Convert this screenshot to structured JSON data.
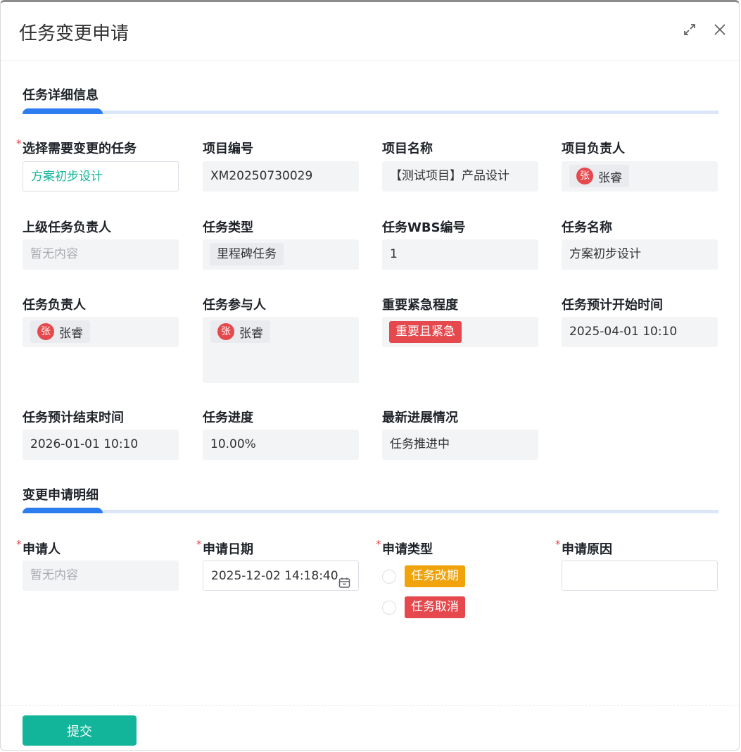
{
  "dialog": {
    "title": "任务变更申请",
    "icons": {
      "expand": "expand-icon",
      "close": "close-icon"
    }
  },
  "section1": {
    "title": "任务详细信息",
    "fields": {
      "task_select": {
        "label": "选择需要变更的任务",
        "value": "方案初步设计"
      },
      "project_code": {
        "label": "项目编号",
        "value": "XM20250730029"
      },
      "project_name": {
        "label": "项目名称",
        "value": "【测试项目】产品设计"
      },
      "project_owner": {
        "label": "项目负责人",
        "avatar": "张",
        "name": "张睿"
      },
      "parent_owner": {
        "label": "上级任务负责人",
        "value": "暂无内容"
      },
      "task_type": {
        "label": "任务类型",
        "value": "里程碑任务"
      },
      "wbs": {
        "label": "任务WBS编号",
        "value": "1"
      },
      "task_name": {
        "label": "任务名称",
        "value": "方案初步设计"
      },
      "task_owner": {
        "label": "任务负责人",
        "avatar": "张",
        "name": "张睿"
      },
      "participants": {
        "label": "任务参与人",
        "avatar": "张",
        "name": "张睿"
      },
      "priority": {
        "label": "重要紧急程度",
        "value": "重要且紧急"
      },
      "start_time": {
        "label": "任务预计开始时间",
        "value": "2025-04-01 10:10"
      },
      "end_time": {
        "label": "任务预计结束时间",
        "value": "2026-01-01 10:10"
      },
      "progress": {
        "label": "任务进度",
        "value": "10.00%"
      },
      "latest": {
        "label": "最新进展情况",
        "value": "任务推进中"
      }
    }
  },
  "section2": {
    "title": "变更申请明细",
    "fields": {
      "applicant": {
        "label": "申请人",
        "value": "暂无内容"
      },
      "apply_date": {
        "label": "申请日期",
        "value": "2025-12-02 14:18:40"
      },
      "apply_type": {
        "label": "申请类型",
        "options": [
          "任务改期",
          "任务取消"
        ]
      },
      "reason": {
        "label": "申请原因",
        "value": ""
      }
    }
  },
  "footer": {
    "submit_label": "提交"
  },
  "colors": {
    "accent_blue": "#2d7cf0",
    "teal": "#13b59a",
    "red": "#e5484d",
    "orange": "#f0a30a"
  },
  "required_mark": "*"
}
